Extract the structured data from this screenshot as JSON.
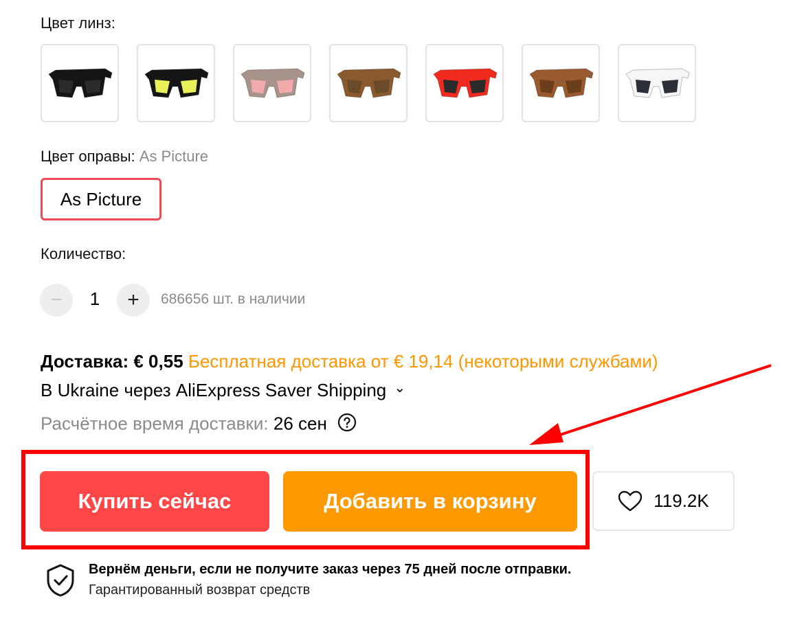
{
  "lens_color": {
    "label": "Цвет линз:",
    "options": [
      {
        "frame": "#151515",
        "lens": "#2b2b2b"
      },
      {
        "frame": "#151515",
        "lens": "#e9f05a"
      },
      {
        "frame": "#a8938a",
        "lens": "#f1a9ab"
      },
      {
        "frame": "#8a5a2e",
        "lens": "#6b4a2a"
      },
      {
        "frame": "#f02a1f",
        "lens": "#2b2b2b"
      },
      {
        "frame": "#9a5a30",
        "lens": "#6b3e1c"
      },
      {
        "frame": "#f6f6f6",
        "lens": "#2b2f36"
      }
    ]
  },
  "frame_color": {
    "label": "Цвет оправы:",
    "selected": "As Picture",
    "option": "As Picture"
  },
  "quantity": {
    "label": "Количество:",
    "minus": "−",
    "plus": "+",
    "value": "1",
    "stock": "686656 шт. в наличии"
  },
  "shipping": {
    "label": "Доставка: € 0,55",
    "free_note": "Бесплатная доставка от € 19,14 (некоторыми службами)",
    "method": "В Ukraine через AliExpress Saver Shipping",
    "chevron": "⌄",
    "eta_label": "Расчётное время доставки:",
    "eta_value": "26 сен",
    "help_icon": "question-circle"
  },
  "actions": {
    "buy_now": "Купить сейчас",
    "add_to_cart": "Добавить в корзину",
    "wishlist_count": "119.2K"
  },
  "guarantee": {
    "title": "Вернём деньги, если не получите заказ через 75 дней после отправки.",
    "subtitle": "Гарантированный возврат средств"
  },
  "colors": {
    "buy": "#ff4747",
    "cart": "#ff9900",
    "highlight": "#ff0000",
    "accent_text": "#ff9600"
  }
}
